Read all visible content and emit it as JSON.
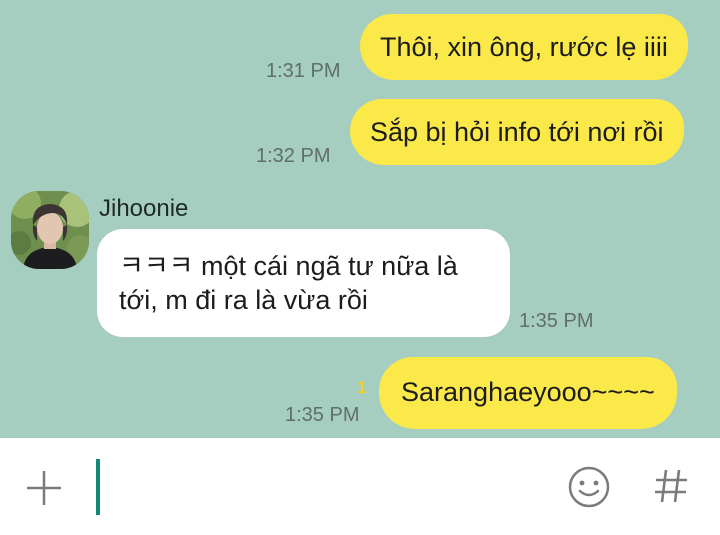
{
  "chat": {
    "messages": [
      {
        "sender": "me",
        "text": "Thôi, xin ông, rước lẹ iiii",
        "time": "1:31 PM"
      },
      {
        "sender": "me",
        "text": "Sắp bị hỏi info tới nơi rồi",
        "time": "1:32 PM"
      },
      {
        "sender": "Jihoonie",
        "text": "ㅋㅋㅋ một cái ngã tư nữa là tới, m đi ra là vừa rồi",
        "time": "1:35 PM"
      },
      {
        "sender": "me",
        "text": "Saranghaeyooo~~~~",
        "time": "1:35 PM",
        "unread_count": "1"
      }
    ],
    "contact": {
      "name": "Jihoonie"
    }
  },
  "input_bar": {
    "text_value": "",
    "icons": [
      "plus-icon",
      "emoji-icon",
      "hash-icon"
    ]
  },
  "colors": {
    "chat_background": "#a5cdc0",
    "my_bubble": "#fbe94a",
    "their_bubble": "#ffffff",
    "cursor": "#0f8a76",
    "unread": "#f5d21a"
  }
}
